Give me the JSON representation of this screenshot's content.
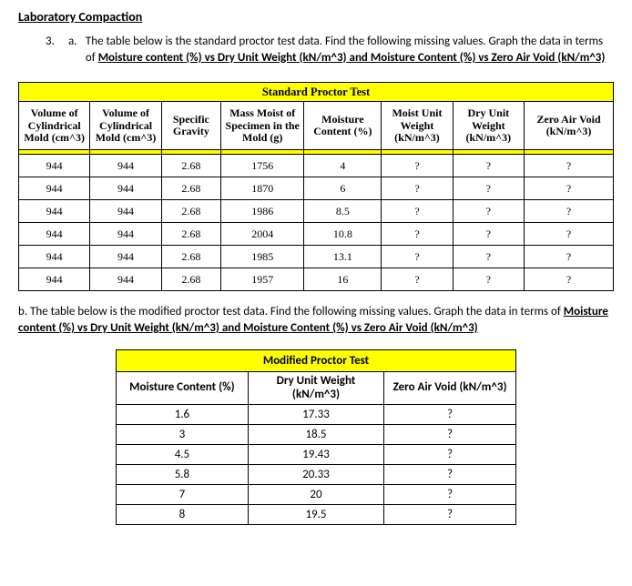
{
  "doc_title": "Laboratory Compaction",
  "q_num": "3.",
  "q_letter": "a.",
  "q_text_lead": "The table below is the standard proctor test data. Find the following missing values. Graph the data in terms of",
  "q_text_und1": " Moisture content (%) vs Dry Unit Weight (kN/m^3) and Moisture Content (%) vs Zero Air Void (kN/m^3)",
  "t1": {
    "title": "Standard Proctor Test",
    "headers": [
      "Volume of Cylindrical Mold (cm^3)",
      "Volume of Cylindrical Mold (cm^3)",
      "Specific Gravity",
      "Mass Moist of Specimen in the Mold (g)",
      "Moisture Content (%)",
      "Moist Unit Weight (kN/m^3)",
      "Dry Unit Weight (kN/m^3)",
      "Zero Air Void (kN/m^3)"
    ],
    "rows": [
      [
        "944",
        "944",
        "2.68",
        "1756",
        "4",
        "?",
        "?",
        "?"
      ],
      [
        "944",
        "944",
        "2.68",
        "1870",
        "6",
        "?",
        "?",
        "?"
      ],
      [
        "944",
        "944",
        "2.68",
        "1986",
        "8.5",
        "?",
        "?",
        "?"
      ],
      [
        "944",
        "944",
        "2.68",
        "2004",
        "10.8",
        "?",
        "?",
        "?"
      ],
      [
        "944",
        "944",
        "2.68",
        "1985",
        "13.1",
        "?",
        "?",
        "?"
      ],
      [
        "944",
        "944",
        "2.68",
        "1957",
        "16",
        "?",
        "?",
        "?"
      ]
    ]
  },
  "part_b_lead": "b. The table below is the modified proctor test data. Find the following missing values. Graph the data in terms of ",
  "part_b_und": "Moisture content (%) vs Dry Unit Weight (kN/m^3) and Moisture Content (%) vs Zero Air Void (kN/m^3)",
  "t2": {
    "title": "Modified Proctor Test",
    "headers": [
      "Moisture Content (%)",
      "Dry Unit Weight (kN/m^3)",
      "Zero Air Void (kN/m^3)"
    ],
    "rows": [
      [
        "1.6",
        "17.33",
        "?"
      ],
      [
        "3",
        "18.5",
        "?"
      ],
      [
        "4.5",
        "19.43",
        "?"
      ],
      [
        "5.8",
        "20.33",
        "?"
      ],
      [
        "7",
        "20",
        "?"
      ],
      [
        "8",
        "19.5",
        "?"
      ]
    ]
  }
}
